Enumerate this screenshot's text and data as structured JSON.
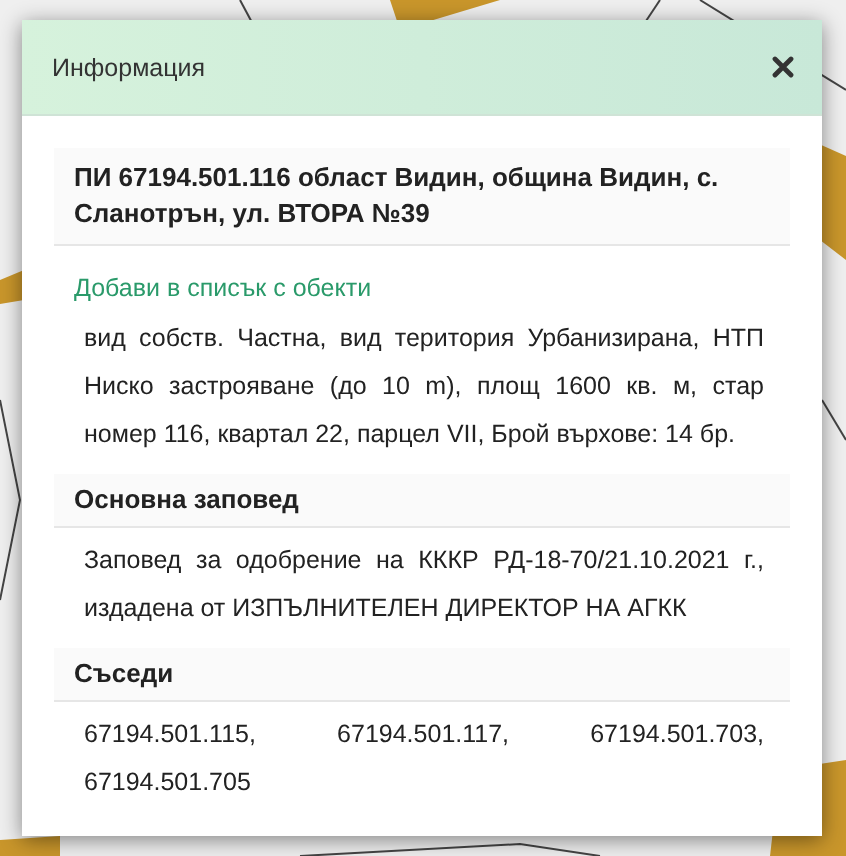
{
  "dialog": {
    "title": "Информация",
    "parcel": {
      "heading": "ПИ 67194.501.116 област Видин, община Видин, с. Сланотрън, ул. ВТОРА №39",
      "link": "Добави в списък с обекти",
      "description": "вид собств. Частна, вид територия Урбанизирана, НТП Ниско застрояване (до 10 m), площ 1600 кв. м, стар номер 116, квартал 22, парцел VII, Брой върхове: 14 бр."
    },
    "sections": [
      {
        "title": "Основна заповед",
        "text": "Заповед за одобрение на КККР РД-18-70/21.10.2021 г., издадена от ИЗПЪЛНИТЕЛЕН ДИРЕКТОР НА АГКК"
      },
      {
        "title": "Съседи",
        "text": "67194.501.115, 67194.501.117, 67194.501.703, 67194.501.705"
      }
    ]
  }
}
